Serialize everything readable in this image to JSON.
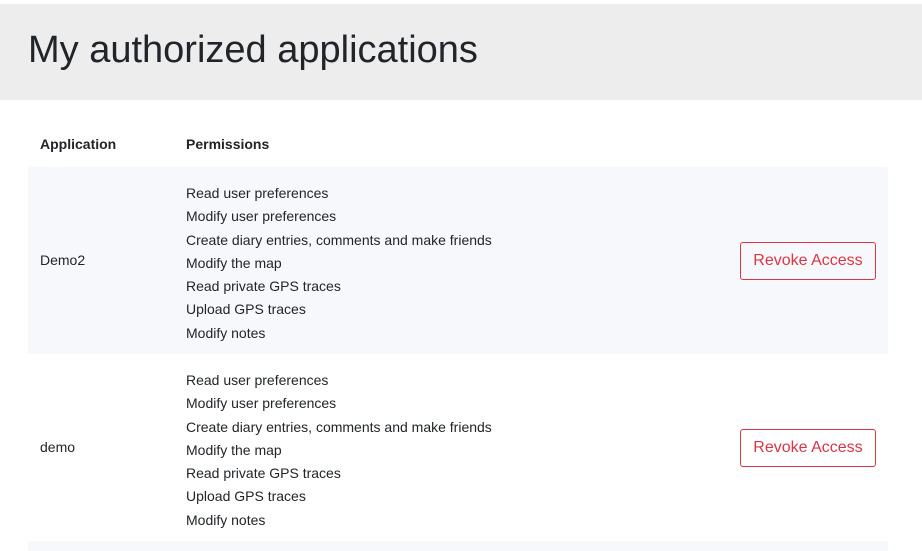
{
  "page": {
    "title": "My authorized applications"
  },
  "table": {
    "headers": {
      "application": "Application",
      "permissions": "Permissions"
    },
    "rows": [
      {
        "application": "Demo2",
        "permissions": [
          "Read user preferences",
          "Modify user preferences",
          "Create diary entries, comments and make friends",
          "Modify the map",
          "Read private GPS traces",
          "Upload GPS traces",
          "Modify notes"
        ],
        "action_label": "Revoke Access"
      },
      {
        "application": "demo",
        "permissions": [
          "Read user preferences",
          "Modify user preferences",
          "Create diary entries, comments and make friends",
          "Modify the map",
          "Read private GPS traces",
          "Upload GPS traces",
          "Modify notes"
        ],
        "action_label": "Revoke Access"
      }
    ]
  },
  "colors": {
    "header_bg": "#ededed",
    "stripe_bg": "#f7f8fc",
    "danger": "#dc3545",
    "text": "#212529"
  }
}
